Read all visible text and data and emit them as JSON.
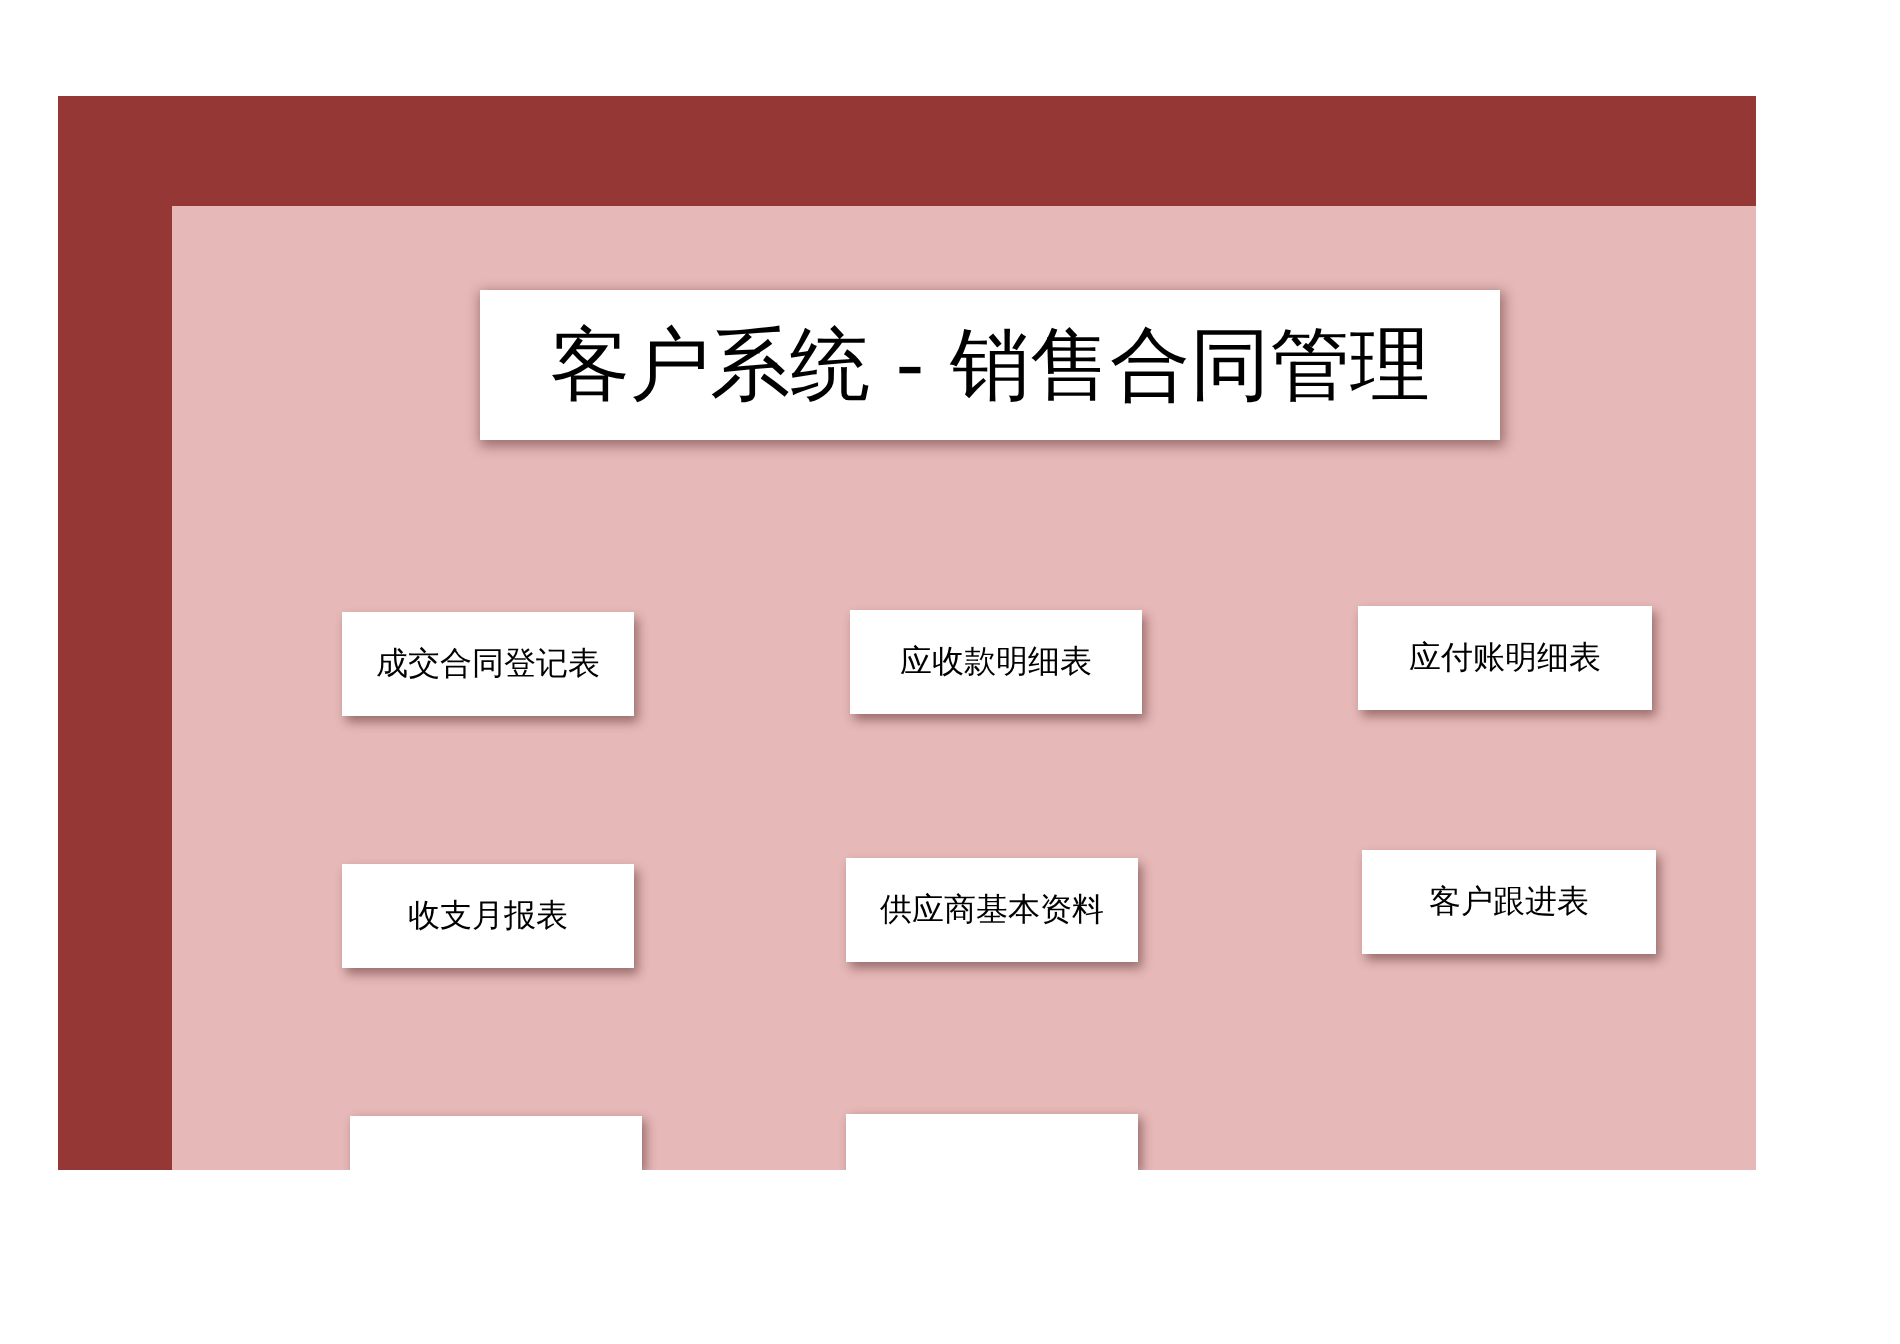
{
  "title": "客户系统 - 销售合同管理",
  "sheet_links": [
    {
      "kind": "button",
      "label": "成交合同登记表"
    },
    {
      "kind": "button",
      "label": "应收款明细表"
    },
    {
      "kind": "button",
      "label": "应付账明细表"
    },
    {
      "kind": "button",
      "label": "收支月报表"
    },
    {
      "kind": "button",
      "label": "供应商基本资料"
    },
    {
      "kind": "button",
      "label": "客户跟进表"
    },
    {
      "kind": "cut-off"
    },
    {
      "kind": "cut-off"
    }
  ]
}
